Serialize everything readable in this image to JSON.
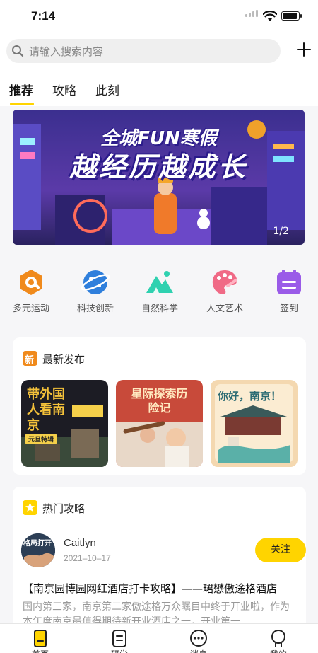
{
  "status_bar": {
    "time": "7:14"
  },
  "header": {
    "search_placeholder": "请输入搜索内容",
    "tabs": [
      {
        "label": "推荐",
        "active": true
      },
      {
        "label": "攻略",
        "active": false
      },
      {
        "label": "此刻",
        "active": false
      }
    ]
  },
  "banner": {
    "headline": "全城FUN寒假",
    "subheadline": "越经历越成长",
    "indicator": "1/2"
  },
  "categories": [
    {
      "label": "多元运动",
      "icon": "sports-icon",
      "color": "#f08a1c"
    },
    {
      "label": "科技创新",
      "icon": "planet-icon",
      "color": "#2f7fdc"
    },
    {
      "label": "自然科学",
      "icon": "mountain-icon",
      "color": "#2fd1b0"
    },
    {
      "label": "人文艺术",
      "icon": "palette-icon",
      "color": "#f06a86"
    },
    {
      "label": "签到",
      "icon": "calendar-icon",
      "color": "#9a5be8"
    }
  ],
  "latest": {
    "badge": "新",
    "title": "最新发布",
    "items": [
      {
        "title": "带外国人看南京",
        "tag": "元旦特辑"
      },
      {
        "title": "星际探索历险记",
        "tag": ""
      },
      {
        "title": "你好，南京！",
        "tag": ""
      }
    ]
  },
  "hot": {
    "title": "热门攻略",
    "post": {
      "avatar_text": "格局打开",
      "author": "Caitlyn",
      "date": "2021–10–17",
      "follow_label": "关注",
      "title": "【南京园博园网红酒店打卡攻略】——珺懋傲途格酒店",
      "excerpt": "国内第三家，南京第二家傲途格万众瞩目中终于开业啦，作为本年度南京最值得期待新开业酒店之一，开业第一"
    }
  },
  "bottom_nav": [
    {
      "label": "首页",
      "icon": "home-icon",
      "active": true
    },
    {
      "label": "研学",
      "icon": "study-icon",
      "active": false
    },
    {
      "label": "消息",
      "icon": "message-icon",
      "active": false
    },
    {
      "label": "我的",
      "icon": "profile-icon",
      "active": false
    }
  ],
  "colors": {
    "accent": "#ffd400",
    "background": "#f6f6f8"
  }
}
